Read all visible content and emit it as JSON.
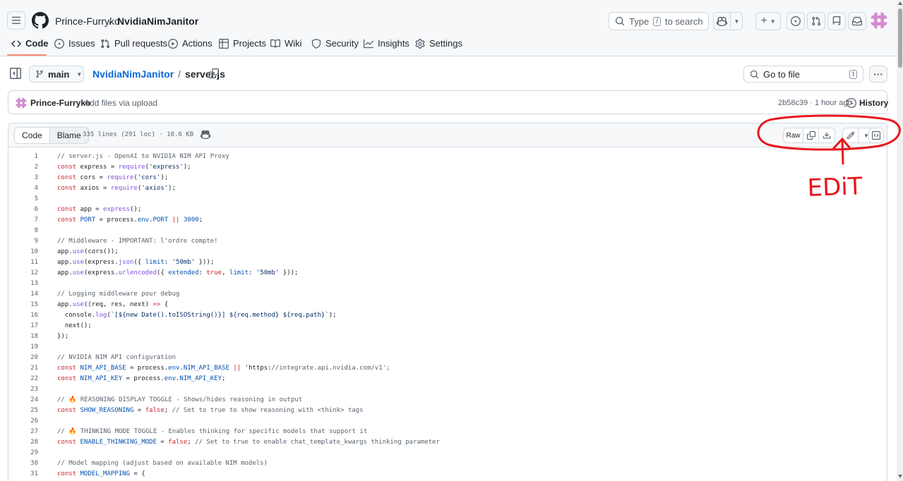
{
  "header": {
    "owner": "Prince-Furryko",
    "separator": "/",
    "repo": "NvidiaNimJanitor",
    "search": {
      "prefix": "Type",
      "key": "/",
      "suffix": "to search"
    }
  },
  "repo_nav": {
    "tabs": [
      {
        "label": "Code",
        "icon": "code-icon"
      },
      {
        "label": "Issues",
        "icon": "issue-opened-icon"
      },
      {
        "label": "Pull requests",
        "icon": "git-pull-request-icon"
      },
      {
        "label": "Actions",
        "icon": "play-icon"
      },
      {
        "label": "Projects",
        "icon": "table-icon"
      },
      {
        "label": "Wiki",
        "icon": "book-icon"
      },
      {
        "label": "Security",
        "icon": "shield-icon"
      },
      {
        "label": "Insights",
        "icon": "graph-icon"
      },
      {
        "label": "Settings",
        "icon": "gear-icon"
      }
    ],
    "active": "Code",
    "active_color": "#fd8c73"
  },
  "file_bar": {
    "branch": "main",
    "repo_link": "NvidiaNimJanitor",
    "separator": "/",
    "file": "server.js",
    "goto_placeholder": "Go to file",
    "goto_key": "t"
  },
  "commit": {
    "author": "Prince-Furryko",
    "message": "Add files via upload",
    "meta": "2b58c39 · 1 hour ago",
    "history_label": "History"
  },
  "viewer": {
    "tab_code": "Code",
    "tab_blame": "Blame",
    "info": "335 lines (291 loc) · 10.6 KB",
    "raw_label": "Raw"
  },
  "annotation": {
    "text": "EDiT",
    "color": "#e8171d"
  },
  "code_lines": [
    {
      "n": "1",
      "t": "// server.js - OpenAI to NVIDIA NIM API Proxy"
    },
    {
      "n": "2",
      "t": "const express = require('express');"
    },
    {
      "n": "3",
      "t": "const cors = require('cors');"
    },
    {
      "n": "4",
      "t": "const axios = require('axios');"
    },
    {
      "n": "5",
      "t": ""
    },
    {
      "n": "6",
      "t": "const app = express();"
    },
    {
      "n": "7",
      "t": "const PORT = process.env.PORT || 3000;"
    },
    {
      "n": "8",
      "t": ""
    },
    {
      "n": "9",
      "t": "// Middleware - IMPORTANT: l'ordre compte!"
    },
    {
      "n": "10",
      "t": "app.use(cors());"
    },
    {
      "n": "11",
      "t": "app.use(express.json({ limit: '50mb' }));"
    },
    {
      "n": "12",
      "t": "app.use(express.urlencoded({ extended: true, limit: '50mb' }));"
    },
    {
      "n": "13",
      "t": ""
    },
    {
      "n": "14",
      "t": "// Logging middleware pour debug"
    },
    {
      "n": "15",
      "t": "app.use((req, res, next) => {"
    },
    {
      "n": "16",
      "t": "  console.log(`[${new Date().toISOString()}] ${req.method} ${req.path}`);"
    },
    {
      "n": "17",
      "t": "  next();"
    },
    {
      "n": "18",
      "t": "});"
    },
    {
      "n": "19",
      "t": ""
    },
    {
      "n": "20",
      "t": "// NVIDIA NIM API configuration"
    },
    {
      "n": "21",
      "t": "const NIM_API_BASE = process.env.NIM_API_BASE || 'https://integrate.api.nvidia.com/v1';"
    },
    {
      "n": "22",
      "t": "const NIM_API_KEY = process.env.NIM_API_KEY;"
    },
    {
      "n": "23",
      "t": ""
    },
    {
      "n": "24",
      "t": "// 🔥 REASONING DISPLAY TOGGLE - Shows/hides reasoning in output"
    },
    {
      "n": "25",
      "t": "const SHOW_REASONING = false; // Set to true to show reasoning with <think> tags"
    },
    {
      "n": "26",
      "t": ""
    },
    {
      "n": "27",
      "t": "// 🔥 THINKING MODE TOGGLE - Enables thinking for specific models that support it"
    },
    {
      "n": "28",
      "t": "const ENABLE_THINKING_MODE = false; // Set to true to enable chat_template_kwargs thinking parameter"
    },
    {
      "n": "29",
      "t": ""
    },
    {
      "n": "30",
      "t": "// Model mapping (adjust based on available NIM models)"
    },
    {
      "n": "31",
      "t": "const MODEL_MAPPING = {"
    }
  ]
}
